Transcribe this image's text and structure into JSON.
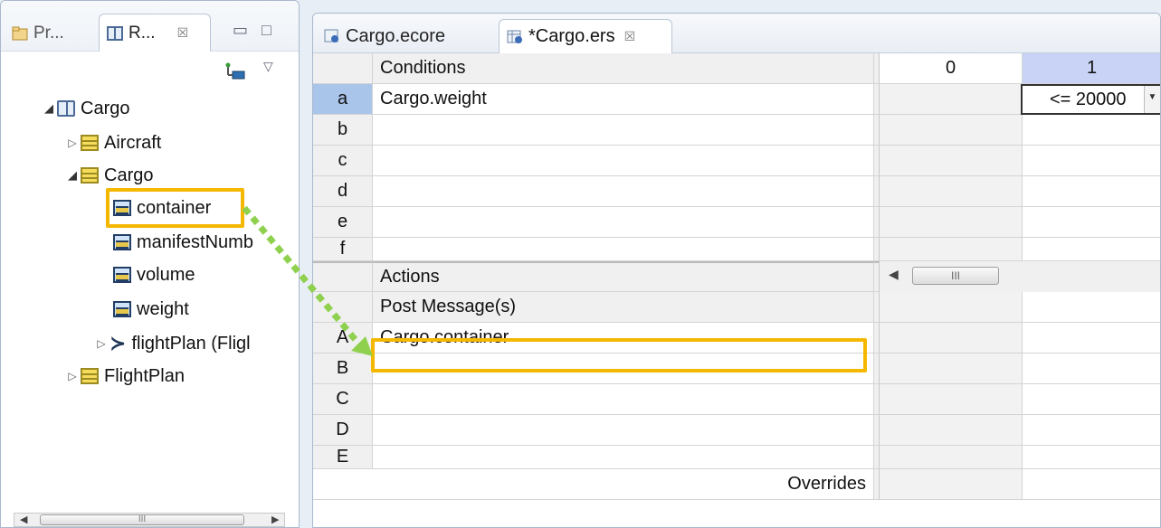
{
  "left_panel": {
    "tabs": [
      {
        "label": "Pr..."
      },
      {
        "label": "R...",
        "close": "☒"
      }
    ],
    "window_buttons": {
      "minimize": "▭",
      "maximize": "□"
    },
    "view_menu": "▽",
    "tree": {
      "root": {
        "label": "Cargo"
      },
      "items": [
        {
          "label": "Aircraft"
        },
        {
          "label": "Cargo"
        },
        {
          "label": "container"
        },
        {
          "label": "manifestNumb"
        },
        {
          "label": "volume"
        },
        {
          "label": "weight"
        },
        {
          "label": "flightPlan (Fligl"
        },
        {
          "label": "FlightPlan"
        }
      ]
    },
    "scrollbar": {
      "left": "◀",
      "thumb": "III",
      "right": "▶"
    }
  },
  "editor": {
    "tabs": [
      {
        "label": "Cargo.ecore"
      },
      {
        "label": "*Cargo.ers",
        "close": "☒"
      }
    ],
    "conditions_header": "Conditions",
    "columns": [
      "0",
      "1"
    ],
    "conditions": [
      {
        "key": "a",
        "text": "Cargo.weight",
        "v1": "<= 20000"
      },
      {
        "key": "b",
        "text": ""
      },
      {
        "key": "c",
        "text": ""
      },
      {
        "key": "d",
        "text": ""
      },
      {
        "key": "e",
        "text": ""
      },
      {
        "key": "f",
        "text": ""
      }
    ],
    "dropdown_arrow": "▼",
    "actions_header": "Actions",
    "post_message_header": "Post Message(s)",
    "actions": [
      {
        "key": "A",
        "text": "Cargo.container"
      },
      {
        "key": "B",
        "text": ""
      },
      {
        "key": "C",
        "text": ""
      },
      {
        "key": "D",
        "text": ""
      },
      {
        "key": "E",
        "text": ""
      }
    ],
    "overrides_label": "Overrides",
    "hscroll": {
      "left": "◀",
      "thumb": "III"
    }
  },
  "colors": {
    "highlight": "#f5b800",
    "arrow": "#8fd14f",
    "selected_header": "#c8d3f5",
    "selected_key": "#a9c5ea"
  }
}
